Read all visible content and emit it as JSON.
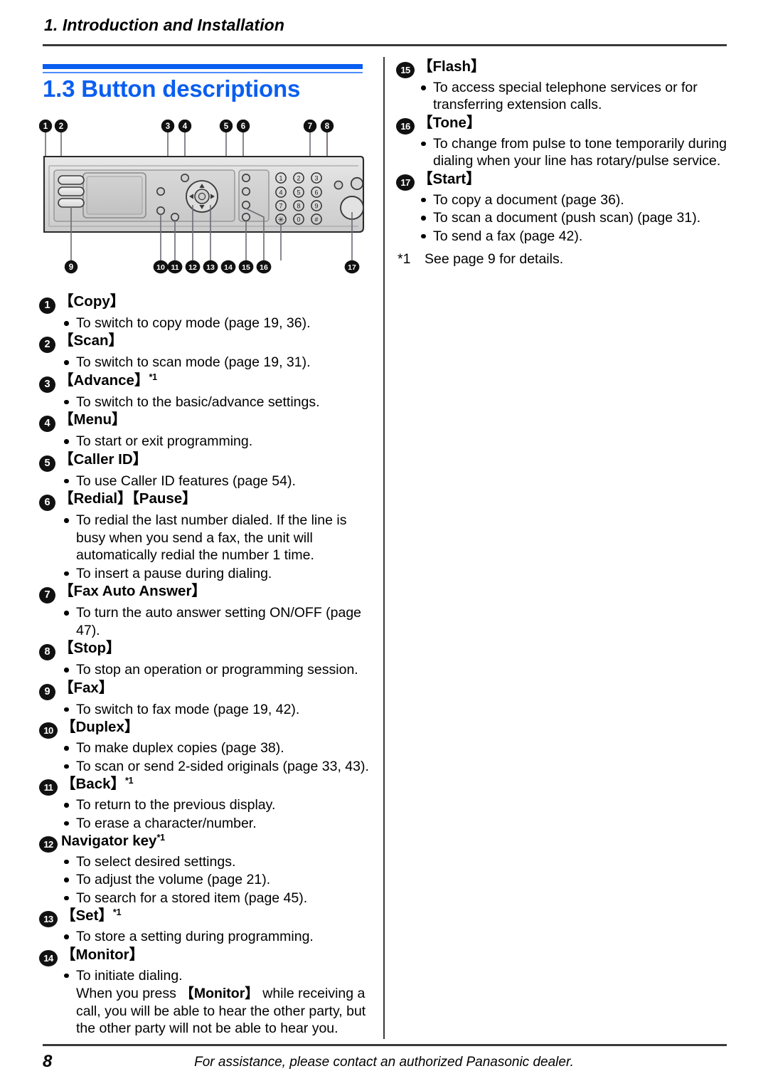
{
  "header": {
    "running_head": "1. Introduction and Installation",
    "section_title": "1.3 Button descriptions",
    "accent_color": "#0a5ef0"
  },
  "figure": {
    "name": "control-panel-diagram",
    "callouts_top": [
      "1",
      "2",
      "3",
      "4",
      "5",
      "6",
      "7",
      "8"
    ],
    "callouts_bottom": [
      "9",
      "10",
      "11",
      "12",
      "13",
      "14",
      "15",
      "16",
      "17"
    ],
    "keypad_keys": [
      "1",
      "2",
      "3",
      "4",
      "5",
      "6",
      "7",
      "8",
      "9",
      "*",
      "0",
      "#"
    ]
  },
  "left_column": {
    "entries": [
      {
        "num": "1",
        "label": "【Copy】",
        "sup": "",
        "bullets": [
          "To switch to copy mode (page 19, 36)."
        ]
      },
      {
        "num": "2",
        "label": "【Scan】",
        "sup": "",
        "bullets": [
          "To switch to scan mode (page 19, 31)."
        ]
      },
      {
        "num": "3",
        "label": "【Advance】",
        "sup": "*1",
        "bullets": [
          "To switch to the basic/advance settings."
        ]
      },
      {
        "num": "4",
        "label": "【Menu】",
        "sup": "",
        "bullets": [
          "To start or exit programming."
        ]
      },
      {
        "num": "5",
        "label": "【Caller ID】",
        "sup": "",
        "bullets": [
          "To use Caller ID features (page 54)."
        ]
      },
      {
        "num": "6",
        "label": "【Redial】【Pause】",
        "sup": "",
        "bullets": [
          "To redial the last number dialed. If the line is busy when you send a fax, the unit will automatically redial the number 1 time.",
          "To insert a pause during dialing."
        ]
      },
      {
        "num": "7",
        "label": "【Fax Auto Answer】",
        "sup": "",
        "bullets": [
          "To turn the auto answer setting ON/OFF (page 47)."
        ]
      },
      {
        "num": "8",
        "label": "【Stop】",
        "sup": "",
        "bullets": [
          "To stop an operation or programming session."
        ]
      },
      {
        "num": "9",
        "label": "【Fax】",
        "sup": "",
        "bullets": [
          "To switch to fax mode (page 19, 42)."
        ]
      },
      {
        "num": "10",
        "label": "【Duplex】",
        "sup": "",
        "bullets": [
          "To make duplex copies (page 38).",
          "To scan or send 2-sided originals (page 33, 43)."
        ]
      },
      {
        "num": "11",
        "label": "【Back】",
        "sup": "*1",
        "bullets": [
          "To return to the previous display.",
          "To erase a character/number."
        ]
      },
      {
        "num": "12",
        "label": "Navigator key",
        "sup": "*1",
        "bullets": [
          "To select desired settings.",
          "To adjust the volume (page 21).",
          "To search for a stored item (page 45)."
        ]
      },
      {
        "num": "13",
        "label": "【Set】",
        "sup": "*1",
        "bullets": [
          "To store a setting during programming."
        ]
      },
      {
        "num": "14",
        "label": "【Monitor】",
        "sup": "",
        "bullets": [
          "To initiate dialing."
        ],
        "continuation": {
          "pre": "When you press ",
          "key": "【Monitor】",
          "post": " while receiving a call, you will be able to hear the other party, but the other party will not be able to hear you."
        }
      }
    ]
  },
  "right_column": {
    "entries": [
      {
        "num": "15",
        "label": "【Flash】",
        "sup": "",
        "bullets": [
          "To access special telephone services or for transferring extension calls."
        ]
      },
      {
        "num": "16",
        "label": "【Tone】",
        "sup": "",
        "bullets": [
          "To change from pulse to tone temporarily during dialing when your line has rotary/pulse service."
        ]
      },
      {
        "num": "17",
        "label": "【Start】",
        "sup": "",
        "bullets": [
          "To copy a document (page 36).",
          "To scan a document (push scan) (page 31).",
          "To send a fax (page 42)."
        ]
      }
    ],
    "footnote_mark": "*1",
    "footnote_text": "See page 9 for details."
  },
  "footer": {
    "page_number": "8",
    "text": "For assistance, please contact an authorized Panasonic dealer."
  }
}
